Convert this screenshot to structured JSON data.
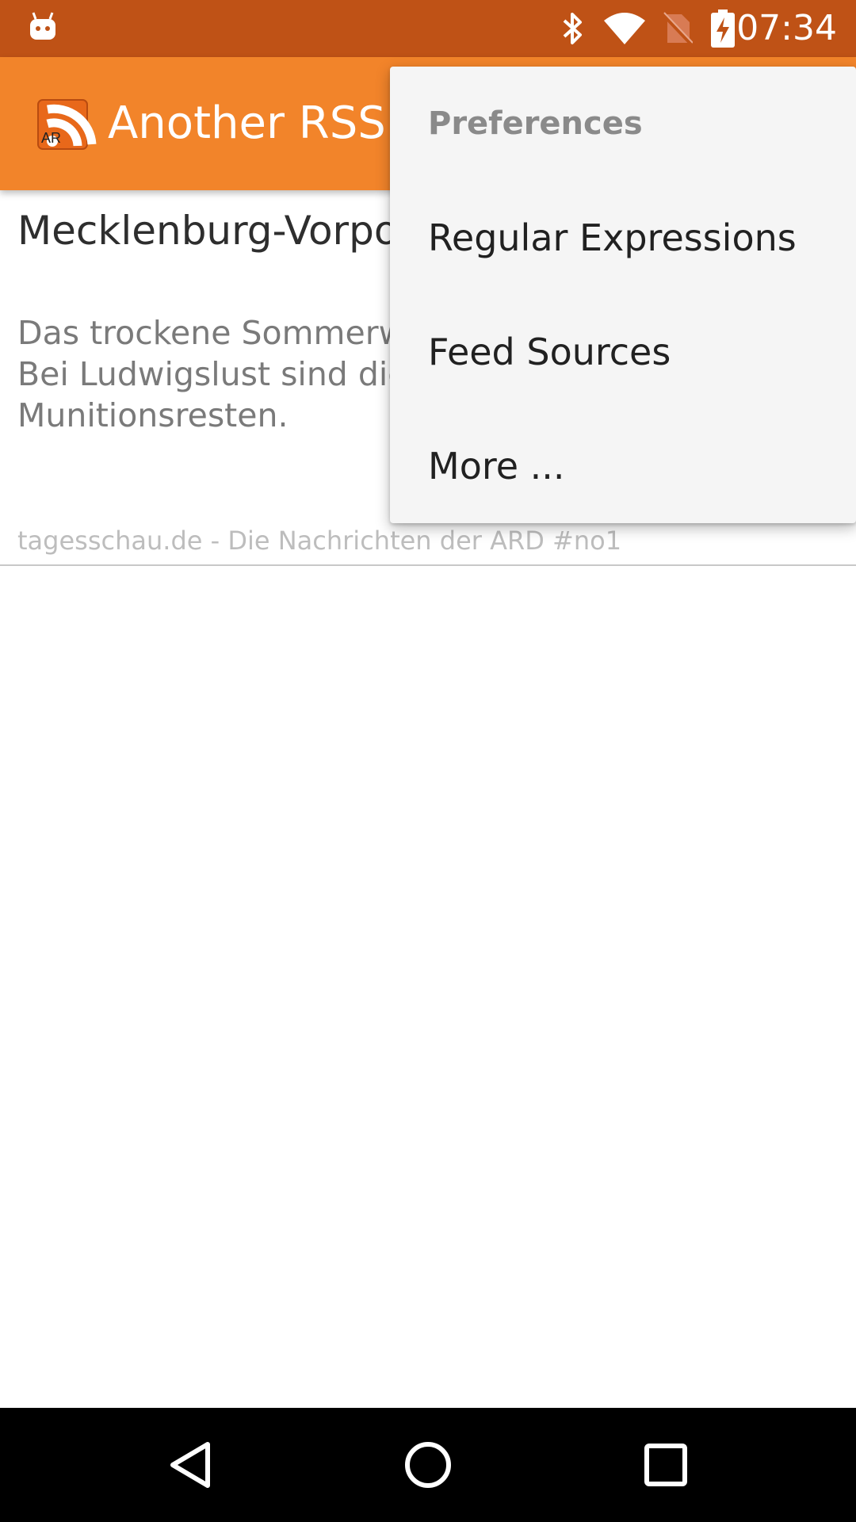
{
  "status_bar": {
    "time": "07:34",
    "left_icon": "android-debug-icon",
    "icons": [
      "bluetooth-icon",
      "wifi-icon",
      "no-sim-icon",
      "battery-charging-icon"
    ]
  },
  "app_bar": {
    "title": "Another RSS",
    "logo_text": "AR",
    "logo_icon": "rss-icon"
  },
  "article": {
    "title": "Mecklenburg-Vorpo Flammen",
    "description": "Das trockene Sommerwe Erntebränden in Meckler Bei Ludwigslust sind die schwierig: Dort brennen Munitionsresten.",
    "source": "tagesschau.de - Die Nachrichten der ARD #no1"
  },
  "menu": {
    "items": [
      {
        "label": "Preferences",
        "enabled": false
      },
      {
        "label": "Regular Expressions",
        "enabled": true
      },
      {
        "label": "Feed Sources",
        "enabled": true
      },
      {
        "label": "More ...",
        "enabled": true
      }
    ]
  },
  "nav_bar": {
    "buttons": [
      "back-icon",
      "home-icon",
      "recents-icon"
    ]
  },
  "colors": {
    "status_bar": "#bf5216",
    "app_bar": "#f2842a",
    "menu_bg": "#f5f5f5"
  }
}
